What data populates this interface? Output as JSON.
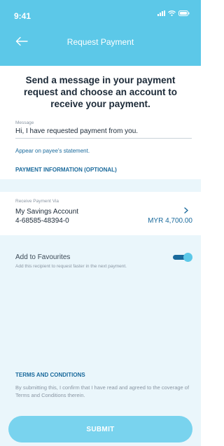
{
  "status_bar": {
    "time": "9:41"
  },
  "header": {
    "title": "Request Payment",
    "back_icon": "arrow-left-icon"
  },
  "intro": {
    "text": "Send a message in your payment request and choose an account to receive your payment."
  },
  "message_field": {
    "label": "Message",
    "value": "Hi, I have requested payment from you."
  },
  "links": {
    "statement_hint": "Appear on payee's statement.",
    "payment_info": "PAYMENT INFORMATION (OPTIONAL)"
  },
  "receive_account": {
    "label": "Receive Payment Via",
    "name": "My Savings Account",
    "number": "4-68585-48394-0",
    "balance": "MYR 4,700.00"
  },
  "favourites": {
    "title": "Add to Favourites",
    "subtitle": "Add this recipient to request faster in the next payment.",
    "enabled": true
  },
  "terms": {
    "title": "TERMS AND CONDITIONS",
    "text": "By submitting this, I confirm that I have read and agreed to the coverage of Terms and Conditions therein."
  },
  "actions": {
    "submit_label": "SUBMIT"
  },
  "colors": {
    "primary": "#5cc8e8",
    "link": "#1a6a9c",
    "background": "#eaf6fb"
  }
}
